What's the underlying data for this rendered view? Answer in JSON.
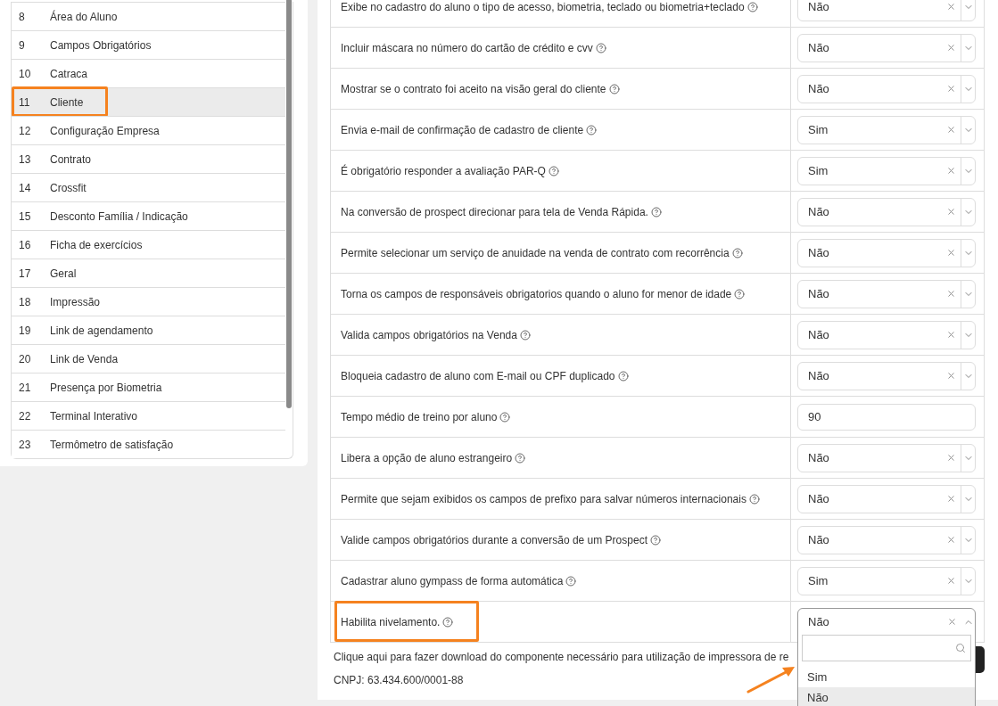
{
  "sidebar": {
    "items": [
      {
        "number": "8",
        "label": "Área do Aluno",
        "selected": false,
        "annotated": false
      },
      {
        "number": "9",
        "label": "Campos Obrigatórios",
        "selected": false,
        "annotated": false
      },
      {
        "number": "10",
        "label": "Catraca",
        "selected": false,
        "annotated": false
      },
      {
        "number": "11",
        "label": "Cliente",
        "selected": true,
        "annotated": true
      },
      {
        "number": "12",
        "label": "Configuração Empresa",
        "selected": false,
        "annotated": false
      },
      {
        "number": "13",
        "label": "Contrato",
        "selected": false,
        "annotated": false
      },
      {
        "number": "14",
        "label": "Crossfit",
        "selected": false,
        "annotated": false
      },
      {
        "number": "15",
        "label": "Desconto Família / Indicação",
        "selected": false,
        "annotated": false
      },
      {
        "number": "16",
        "label": "Ficha de exercícios",
        "selected": false,
        "annotated": false
      },
      {
        "number": "17",
        "label": "Geral",
        "selected": false,
        "annotated": false
      },
      {
        "number": "18",
        "label": "Impressão",
        "selected": false,
        "annotated": false
      },
      {
        "number": "19",
        "label": "Link de agendamento",
        "selected": false,
        "annotated": false
      },
      {
        "number": "20",
        "label": "Link de Venda",
        "selected": false,
        "annotated": false
      },
      {
        "number": "21",
        "label": "Presença por Biometria",
        "selected": false,
        "annotated": false
      },
      {
        "number": "22",
        "label": "Terminal Interativo",
        "selected": false,
        "annotated": false
      },
      {
        "number": "23",
        "label": "Termômetro de satisfação",
        "selected": false,
        "annotated": false
      }
    ]
  },
  "settings": [
    {
      "label": "Exibe no cadastro do aluno o tipo de acesso, biometria, teclado ou biometria+teclado",
      "kind": "select",
      "value": "Não",
      "annotated": false
    },
    {
      "label": "Incluir máscara no número do cartão de crédito e cvv",
      "kind": "select",
      "value": "Não",
      "annotated": false
    },
    {
      "label": "Mostrar se o contrato foi aceito na visão geral do cliente",
      "kind": "select",
      "value": "Não",
      "annotated": false
    },
    {
      "label": "Envia e-mail de confirmação de cadastro de cliente",
      "kind": "select",
      "value": "Sim",
      "annotated": false
    },
    {
      "label": "É obrigatório responder a avaliação PAR-Q",
      "kind": "select",
      "value": "Sim",
      "annotated": false
    },
    {
      "label": "Na conversão de prospect direcionar para tela de Venda Rápida.",
      "kind": "select",
      "value": "Não",
      "annotated": false
    },
    {
      "label": "Permite selecionar um serviço de anuidade na venda de contrato com recorrência",
      "kind": "select",
      "value": "Não",
      "annotated": false
    },
    {
      "label": "Torna os campos de responsáveis obrigatorios quando o aluno for menor de idade",
      "kind": "select",
      "value": "Não",
      "annotated": false
    },
    {
      "label": "Valida campos obrigatórios na Venda",
      "kind": "select",
      "value": "Não",
      "annotated": false
    },
    {
      "label": "Bloqueia cadastro de aluno com E-mail ou CPF duplicado",
      "kind": "select",
      "value": "Não",
      "annotated": false
    },
    {
      "label": "Tempo médio de treino por aluno",
      "kind": "input",
      "value": "90",
      "annotated": false
    },
    {
      "label": "Libera a opção de aluno estrangeiro",
      "kind": "select",
      "value": "Não",
      "annotated": false
    },
    {
      "label": "Permite que sejam exibidos os campos de prefixo para salvar números internacionais",
      "kind": "select",
      "value": "Não",
      "annotated": false
    },
    {
      "label": "Valide campos obrigatórios durante a conversão de um Prospect",
      "kind": "select",
      "value": "Não",
      "annotated": false
    },
    {
      "label": "Cadastrar aluno gympass de forma automática",
      "kind": "select",
      "value": "Sim",
      "annotated": false
    },
    {
      "label": "Habilita nivelamento.",
      "kind": "select",
      "value": "Não",
      "annotated": true,
      "open": true,
      "options": [
        {
          "label": "Sim",
          "selected": false,
          "pointed": true
        },
        {
          "label": "Não",
          "selected": true,
          "pointed": false
        }
      ]
    }
  ],
  "footer": {
    "download_text": "Clique aqui para fazer download do componente necessário para utilização de impressora de re",
    "cnpj": "CNPJ: 63.434.600/0001-88"
  }
}
